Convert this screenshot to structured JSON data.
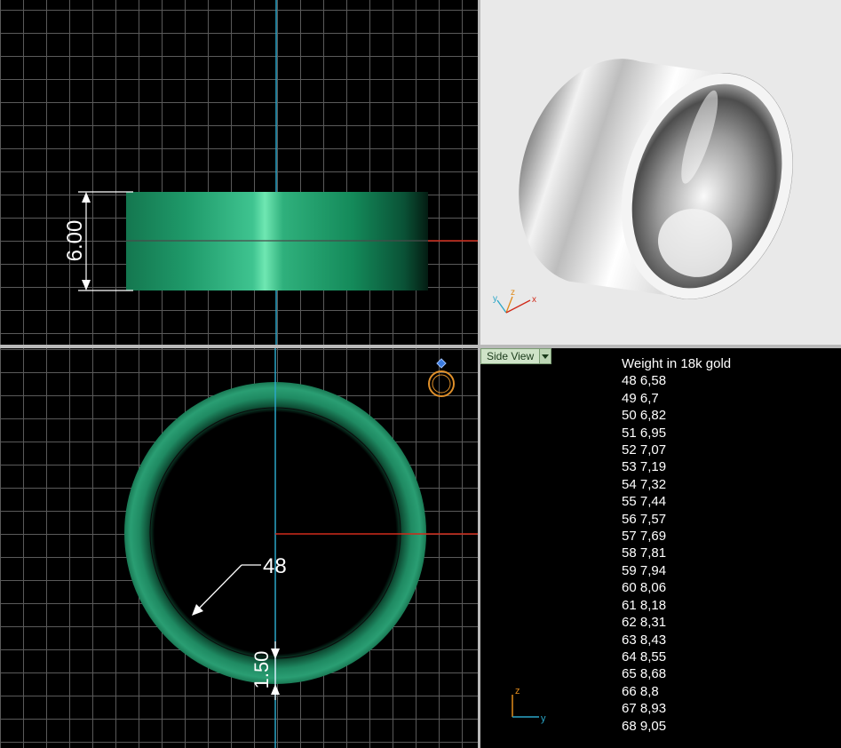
{
  "front_view": {
    "height_dimension": "6.00"
  },
  "top_view": {
    "size_label": "48",
    "thickness_dimension": "1.50"
  },
  "perspective_view": {
    "axis_labels": {
      "y": "y",
      "z": "z",
      "x": "x"
    }
  },
  "side_view": {
    "view_selector": "Side View",
    "weights_title": "Weight in 18k gold",
    "weights": [
      {
        "size": "48",
        "weight": "6,58"
      },
      {
        "size": "49",
        "weight": "6,7"
      },
      {
        "size": "50",
        "weight": "6,82"
      },
      {
        "size": "51",
        "weight": "6,95"
      },
      {
        "size": "52",
        "weight": "7,07"
      },
      {
        "size": "53",
        "weight": "7,19"
      },
      {
        "size": "54",
        "weight": "7,32"
      },
      {
        "size": "55",
        "weight": "7,44"
      },
      {
        "size": "56",
        "weight": "7,57"
      },
      {
        "size": "57",
        "weight": "7,69"
      },
      {
        "size": "58",
        "weight": "7,81"
      },
      {
        "size": "59",
        "weight": "7,94"
      },
      {
        "size": "60",
        "weight": "8,06"
      },
      {
        "size": "61",
        "weight": "8,18"
      },
      {
        "size": "62",
        "weight": "8,31"
      },
      {
        "size": "63",
        "weight": "8,43"
      },
      {
        "size": "64",
        "weight": "8,55"
      },
      {
        "size": "65",
        "weight": "8,68"
      },
      {
        "size": "66",
        "weight": "8,8"
      },
      {
        "size": "67",
        "weight": "8,93"
      },
      {
        "size": "68",
        "weight": "9,05"
      }
    ],
    "axis_labels": {
      "z": "z",
      "y": "y"
    }
  },
  "colors": {
    "ring_green": "#1f8a62",
    "axis_red": "#d02a1a",
    "axis_cyan": "#2aa6c8",
    "grid": "#5a5a5a"
  }
}
